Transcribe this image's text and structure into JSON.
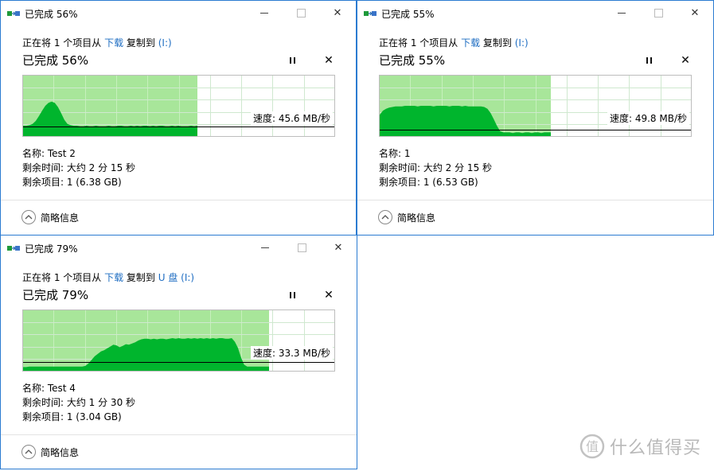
{
  "colors": {
    "accent": "#2b7bd1",
    "link": "#1e6dc2",
    "graph_fill": "#00b52d",
    "progress_bg": "#a8e69a",
    "grid": "#cfe8cf"
  },
  "icons": {
    "app": "copy-transfer-icon",
    "minimize": "minimize-icon",
    "maximize": "maximize-icon",
    "close": "close-icon",
    "pause": "pause-icon",
    "stop": "stop-icon",
    "more": "chevron-up-icon"
  },
  "labels": {
    "minimize": "",
    "maximize": "",
    "close": "✕",
    "stop": "✕",
    "more_details": "简略信息"
  },
  "dialogs": [
    {
      "title": "已完成 56%",
      "line1_prefix": "正在将 1 个项目从 ",
      "source": "下载",
      "line1_mid": " 复制到 ",
      "destination": "(I:)",
      "big_status": "已完成 56%",
      "progress": 0.56,
      "speed": "速度: 45.6 MB/秒",
      "name": "名称: Test 2",
      "time_remaining": "剩余时间: 大约 2 分 15 秒",
      "items_remaining": "剩余项目: 1 (6.38 GB)",
      "speed_graph": [
        0.17,
        0.17,
        0.18,
        0.2,
        0.25,
        0.33,
        0.42,
        0.5,
        0.55,
        0.57,
        0.55,
        0.48,
        0.38,
        0.27,
        0.2,
        0.18,
        0.17,
        0.17,
        0.16,
        0.16,
        0.17,
        0.16,
        0.16,
        0.17,
        0.16,
        0.16,
        0.16,
        0.17,
        0.16,
        0.16,
        0.17,
        0.17,
        0.16,
        0.16,
        0.17,
        0.16,
        0.17,
        0.16,
        0.17,
        0.17,
        0.16,
        0.17,
        0.16,
        0.17,
        0.17,
        0.16,
        0.16,
        0.17,
        0.16,
        0.17,
        0.16,
        0.16,
        0.16,
        0.17,
        0.16,
        0.17
      ],
      "avg_line": 0.16
    },
    {
      "title": "已完成 55%",
      "line1_prefix": "正在将 1 个项目从 ",
      "source": "下载",
      "line1_mid": " 复制到 ",
      "destination": "(I:)",
      "big_status": "已完成 55%",
      "progress": 0.55,
      "speed": "速度: 49.8 MB/秒",
      "name": "名称: 1",
      "time_remaining": "剩余时间: 大约 2 分 15 秒",
      "items_remaining": "剩余项目: 1 (6.53 GB)",
      "speed_graph": [
        0.35,
        0.42,
        0.45,
        0.47,
        0.48,
        0.49,
        0.49,
        0.49,
        0.5,
        0.5,
        0.5,
        0.5,
        0.49,
        0.5,
        0.5,
        0.5,
        0.5,
        0.49,
        0.5,
        0.5,
        0.5,
        0.5,
        0.49,
        0.5,
        0.5,
        0.5,
        0.49,
        0.5,
        0.49,
        0.49,
        0.49,
        0.49,
        0.49,
        0.48,
        0.45,
        0.38,
        0.28,
        0.17,
        0.08,
        0.06,
        0.06,
        0.06,
        0.05,
        0.06,
        0.06,
        0.05,
        0.06,
        0.06,
        0.05,
        0.06,
        0.06,
        0.05,
        0.06,
        0.06,
        0.06
      ],
      "avg_line": 0.1
    },
    {
      "title": "已完成 79%",
      "line1_prefix": "正在将 1 个项目从 ",
      "source": "下载",
      "line1_mid": " 复制到 ",
      "destination": "U 盘 (I:)",
      "big_status": "已完成 79%",
      "progress": 0.79,
      "speed": "速度: 33.3 MB/秒",
      "name": "名称: Test 4",
      "time_remaining": "剩余时间: 大约 1 分 30 秒",
      "items_remaining": "剩余项目: 1 (3.04 GB)",
      "speed_graph": [
        0.06,
        0.06,
        0.07,
        0.07,
        0.07,
        0.07,
        0.07,
        0.07,
        0.07,
        0.07,
        0.07,
        0.07,
        0.07,
        0.07,
        0.07,
        0.07,
        0.07,
        0.07,
        0.07,
        0.07,
        0.08,
        0.12,
        0.18,
        0.24,
        0.28,
        0.32,
        0.34,
        0.37,
        0.4,
        0.43,
        0.42,
        0.39,
        0.41,
        0.44,
        0.43,
        0.45,
        0.47,
        0.5,
        0.52,
        0.53,
        0.53,
        0.52,
        0.53,
        0.52,
        0.53,
        0.53,
        0.52,
        0.53,
        0.54,
        0.53,
        0.54,
        0.53,
        0.53,
        0.54,
        0.53,
        0.54,
        0.53,
        0.54,
        0.53,
        0.54,
        0.53,
        0.54,
        0.53,
        0.54,
        0.54,
        0.53,
        0.53,
        0.54,
        0.48,
        0.38,
        0.22,
        0.1,
        0.07,
        0.07,
        0.07,
        0.07,
        0.07,
        0.07,
        0.07,
        0.07
      ],
      "avg_line": 0.14
    }
  ],
  "watermark": {
    "text": "什么值得买",
    "icon": "zhi-logo-icon"
  }
}
